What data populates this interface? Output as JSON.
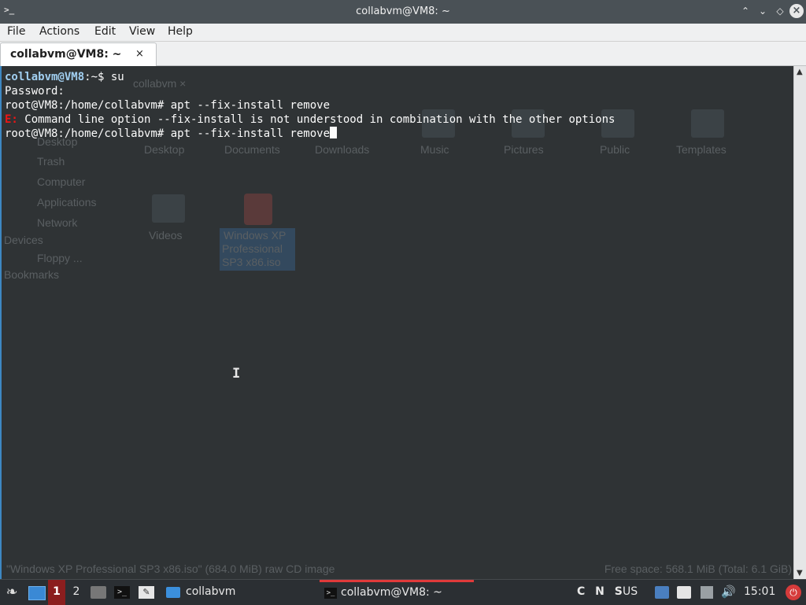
{
  "window": {
    "title": "collabvm@VM8: ~",
    "app_icon": ">_",
    "buttons": {
      "keep_above": "⌃",
      "minimize": "⌄",
      "maximize": "◇",
      "close": "×"
    }
  },
  "menubar": {
    "items": [
      "File",
      "Actions",
      "Edit",
      "View",
      "Help"
    ]
  },
  "tab": {
    "label": "collabvm@VM8: ~",
    "close": "×"
  },
  "terminal": {
    "line1_user": "collabvm@VM8",
    "line1_rest": ":~$ su",
    "line2": "Password:",
    "line3": "root@VM8:/home/collabvm# apt --fix-install remove",
    "line4_prefix": "E:",
    "line4_rest": " Command line option --fix-install is not understood in combination with the other options",
    "line5": "root@VM8:/home/collabvm# apt --fix-install remove"
  },
  "background_file_manager": {
    "tab": "collabvm ×",
    "sidebar": [
      "Desktop",
      "Trash",
      "Computer",
      "Applications",
      "Network"
    ],
    "devices_header": "Devices",
    "device": "Floppy ...",
    "bookmarks_header": "Bookmarks",
    "folders": [
      "Desktop",
      "Documents",
      "Downloads",
      "Music",
      "Pictures",
      "Public",
      "Templates"
    ],
    "row2": [
      "Videos"
    ],
    "selected_file": [
      "Windows XP",
      "Professional",
      "SP3 x86.iso"
    ],
    "status_left": "\"Windows XP Professional SP3 x86.iso\" (684.0 MiB) raw CD image",
    "status_right": "Free space: 568.1 MiB (Total: 6.1 GiB)"
  },
  "taskbar": {
    "workspace_1": "1",
    "workspace_2": "2",
    "file_manager_task": "collabvm",
    "active_task": "collabvm@VM8: ~",
    "kb_locks": "C N S",
    "kb_layout": "US",
    "volume_icon": "🔊",
    "clock": "15:01",
    "power_icon": "⏻"
  },
  "colors": {
    "accent": "#3d87c2",
    "terminal_bg": "#2f3335",
    "prompt_user": "#a1cff1",
    "error": "#ed1515",
    "active_task_bar": "#e03a3a"
  }
}
